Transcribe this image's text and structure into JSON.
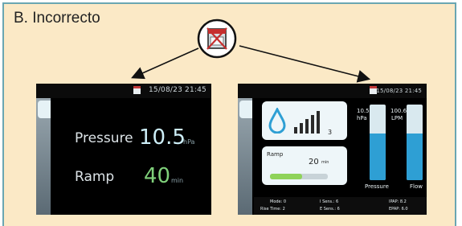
{
  "heading": "B. Incorrecto",
  "colors": {
    "panel_bg": "#fbe9c6",
    "border": "#6aa6b2",
    "pressure_value": "#cdeef7",
    "ramp_value": "#7fd07a",
    "gauge_fill": "#2e9fd4"
  },
  "icons": {
    "callout": "warning-crossed-device-icon"
  },
  "screen_a": {
    "datetime": "15/08/23 21:45",
    "pressure_label": "Pressure",
    "pressure_value": "10.5",
    "pressure_unit": "hPa",
    "ramp_label": "Ramp",
    "ramp_value": "40",
    "ramp_unit": "min"
  },
  "screen_b": {
    "datetime": "15/08/23 21:45",
    "level_value": "3",
    "ramp_label": "Ramp",
    "ramp_value": "20",
    "ramp_unit": "min",
    "ramp_progress": 0.55,
    "pressure_value": "10.5",
    "pressure_unit": "hPa",
    "flow_value": "100.6",
    "flow_unit": "LPM",
    "pressure_level": 0.62,
    "flow_level": 0.62,
    "pressure_caption": "Pressure",
    "flow_caption": "Flow",
    "footer": {
      "mode": "Mode: 0",
      "rise_time": "Rise Time: 2",
      "i_sens": "I Sens.: 6",
      "e_sens": "E Sens.: 6",
      "ipap": "IPAP: 8.2",
      "epap": "EPAP: 6.0"
    }
  }
}
